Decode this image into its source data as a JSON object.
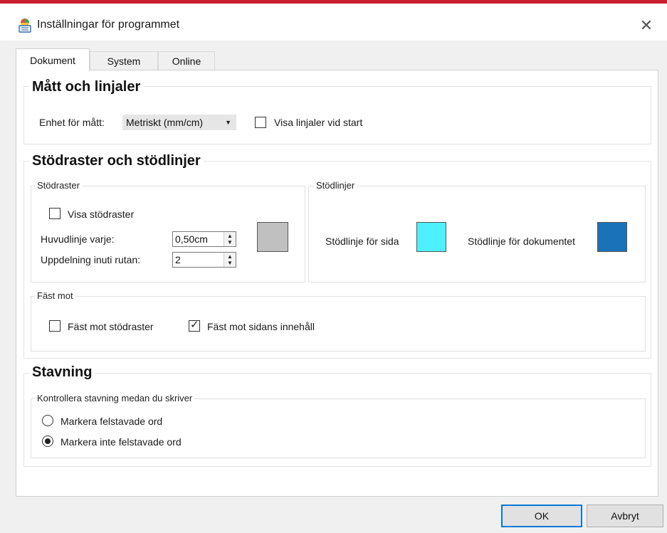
{
  "window": {
    "title": "Inställningar för programmet",
    "close_glyph": "✕",
    "app_icon": "settings-app-icon",
    "accent_color": "#c8202f"
  },
  "tabs": [
    {
      "label": "Dokument",
      "active": true
    },
    {
      "label": "System",
      "active": false
    },
    {
      "label": "Online",
      "active": false
    }
  ],
  "measures": {
    "title": "Mått och linjaler",
    "unit_label": "Enhet för mått:",
    "unit_value": "Metriskt (mm/cm)",
    "rulers_label": "Visa linjaler vid start",
    "rulers_checked": false
  },
  "guides": {
    "title": "Stödraster och stödlinjer",
    "grid": {
      "title": "Stödraster",
      "show_label": "Visa stödraster",
      "show_checked": false,
      "major_label": "Huvudlinje varje:",
      "major_value": "0,50cm",
      "subdivision_label": "Uppdelning inuti rutan:",
      "subdivision_value": "2",
      "color": "#c0c0c0"
    },
    "lines": {
      "title": "Stödlinjer",
      "page_label": "Stödlinje för sida",
      "page_color": "#4ef0ff",
      "doc_label": "Stödlinje för dokumentet",
      "doc_color": "#1a72b8"
    },
    "snap": {
      "title": "Fäst mot",
      "grid_label": "Fäst mot stödraster",
      "grid_checked": false,
      "content_label": "Fäst mot sidans innehåll",
      "content_checked": true,
      "check_glyph": "✓"
    }
  },
  "spelling": {
    "title": "Stavning",
    "group_title": "Kontrollera stavning medan du skriver",
    "option_mark": "Markera felstavade ord",
    "option_nomark": "Markera inte felstavade ord",
    "selected": "option_nomark"
  },
  "buttons": {
    "ok": "OK",
    "cancel": "Avbryt"
  }
}
